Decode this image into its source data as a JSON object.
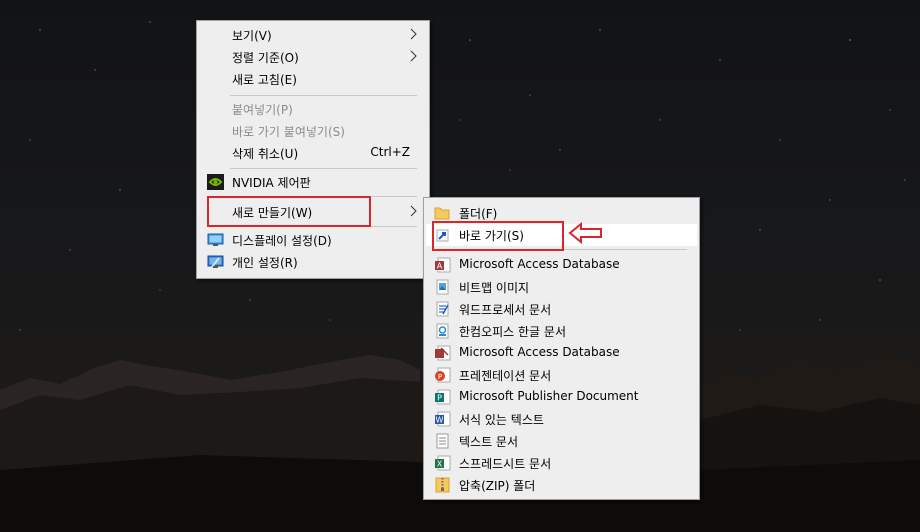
{
  "context_menu": {
    "items": [
      {
        "label": "보기(V)"
      },
      {
        "label": "정렬 기준(O)"
      },
      {
        "label": "새로 고침(E)"
      },
      {
        "label": "붙여넣기(P)"
      },
      {
        "label": "바로 가기 붙여넣기(S)"
      },
      {
        "label": "삭제 취소(U)",
        "shortcut": "Ctrl+Z"
      },
      {
        "label": "NVIDIA 제어판"
      },
      {
        "label": "새로 만들기(W)"
      },
      {
        "label": "디스플레이 설정(D)"
      },
      {
        "label": "개인 설정(R)"
      }
    ]
  },
  "new_submenu": {
    "items": [
      {
        "label": "폴더(F)",
        "icon": "folder-icon"
      },
      {
        "label": "바로 가기(S)",
        "icon": "shortcut-icon"
      },
      {
        "label": "Microsoft Access Database",
        "icon": "access-icon"
      },
      {
        "label": "비트맵 이미지",
        "icon": "bitmap-icon"
      },
      {
        "label": "워드프로세서 문서",
        "icon": "wordpad-icon"
      },
      {
        "label": "한컴오피스 한글 문서",
        "icon": "hwp-icon"
      },
      {
        "label": "Microsoft Access Database",
        "icon": "access-icon"
      },
      {
        "label": "프레젠테이션 문서",
        "icon": "powerpoint-icon"
      },
      {
        "label": "Microsoft Publisher Document",
        "icon": "publisher-icon"
      },
      {
        "label": "서식 있는 텍스트",
        "icon": "word-icon"
      },
      {
        "label": "텍스트 문서",
        "icon": "text-document-icon"
      },
      {
        "label": "스프레드시트 문서",
        "icon": "excel-icon"
      },
      {
        "label": "압축(ZIP) 폴더",
        "icon": "zip-folder-icon"
      }
    ]
  },
  "annotations": {
    "highlight_color": "#d8262c"
  }
}
